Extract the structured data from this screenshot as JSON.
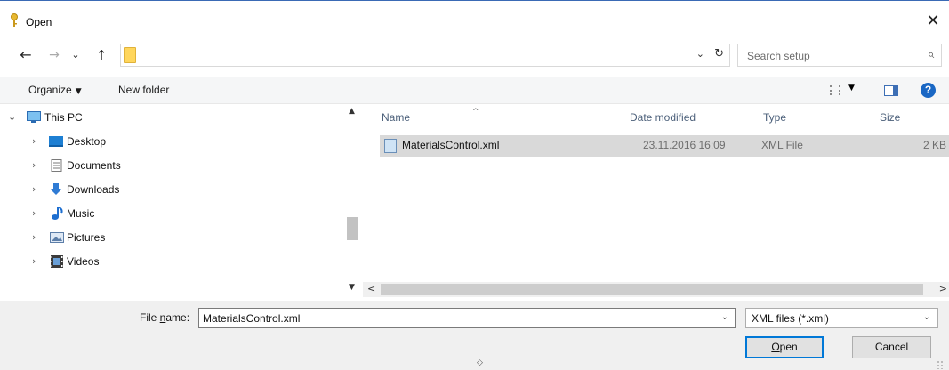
{
  "window": {
    "title": "Open",
    "close_glyph": "✕"
  },
  "nav": {
    "back_glyph": "←",
    "forward_glyph": "→",
    "recent_glyph": "⌄",
    "up_glyph": "↑",
    "address_path": "",
    "address_dropdown_glyph": "⌄",
    "refresh_glyph": "↻",
    "search_placeholder": "Search setup",
    "search_glyph": "⌕"
  },
  "toolbar": {
    "organize_label": "Organize",
    "organize_caret": "▼",
    "new_folder_label": "New folder",
    "views_caret": "▼",
    "help_label": "?"
  },
  "tree": {
    "scroll_up": "▲",
    "scroll_down": "▼",
    "items": [
      {
        "label": "This PC",
        "chevron": "⌄",
        "icon": "computer-icon",
        "color": "#3b8fd6"
      },
      {
        "label": "Desktop",
        "chevron": "›",
        "icon": "desktop-icon",
        "color": "#1d7fd3"
      },
      {
        "label": "Documents",
        "chevron": "›",
        "icon": "documents-icon",
        "color": "#8a8a8a"
      },
      {
        "label": "Downloads",
        "chevron": "›",
        "icon": "downloads-icon",
        "color": "#2f7bd4"
      },
      {
        "label": "Music",
        "chevron": "›",
        "icon": "music-icon",
        "color": "#1e6fd0"
      },
      {
        "label": "Pictures",
        "chevron": "›",
        "icon": "pictures-icon",
        "color": "#5c7ea8"
      },
      {
        "label": "Videos",
        "chevron": "›",
        "icon": "videos-icon",
        "color": "#3b3b3b"
      }
    ]
  },
  "files": {
    "sort_caret": "^",
    "columns": {
      "name": "Name",
      "date": "Date modified",
      "type": "Type",
      "size": "Size"
    },
    "rows": [
      {
        "name": "MaterialsControl.xml",
        "date": "23.11.2016 16:09",
        "type": "XML File",
        "size": "2 KB"
      }
    ],
    "scroll_left": "<",
    "scroll_right": ">"
  },
  "footer": {
    "file_name_label_prefix": "File ",
    "file_name_label_underlined": "n",
    "file_name_label_suffix": "ame:",
    "file_name_value": "MaterialsControl.xml",
    "file_name_dropdown": "⌄",
    "file_type_value": "XML files (*.xml)",
    "file_type_dropdown": "⌄",
    "open_label_underlined": "O",
    "open_label_rest": "pen",
    "cancel_label": "Cancel",
    "resize_glyph": "◇"
  },
  "colors": {
    "selected_row": "#d9d9d9",
    "accent": "#0078d7",
    "header_text": "#4c607a"
  }
}
